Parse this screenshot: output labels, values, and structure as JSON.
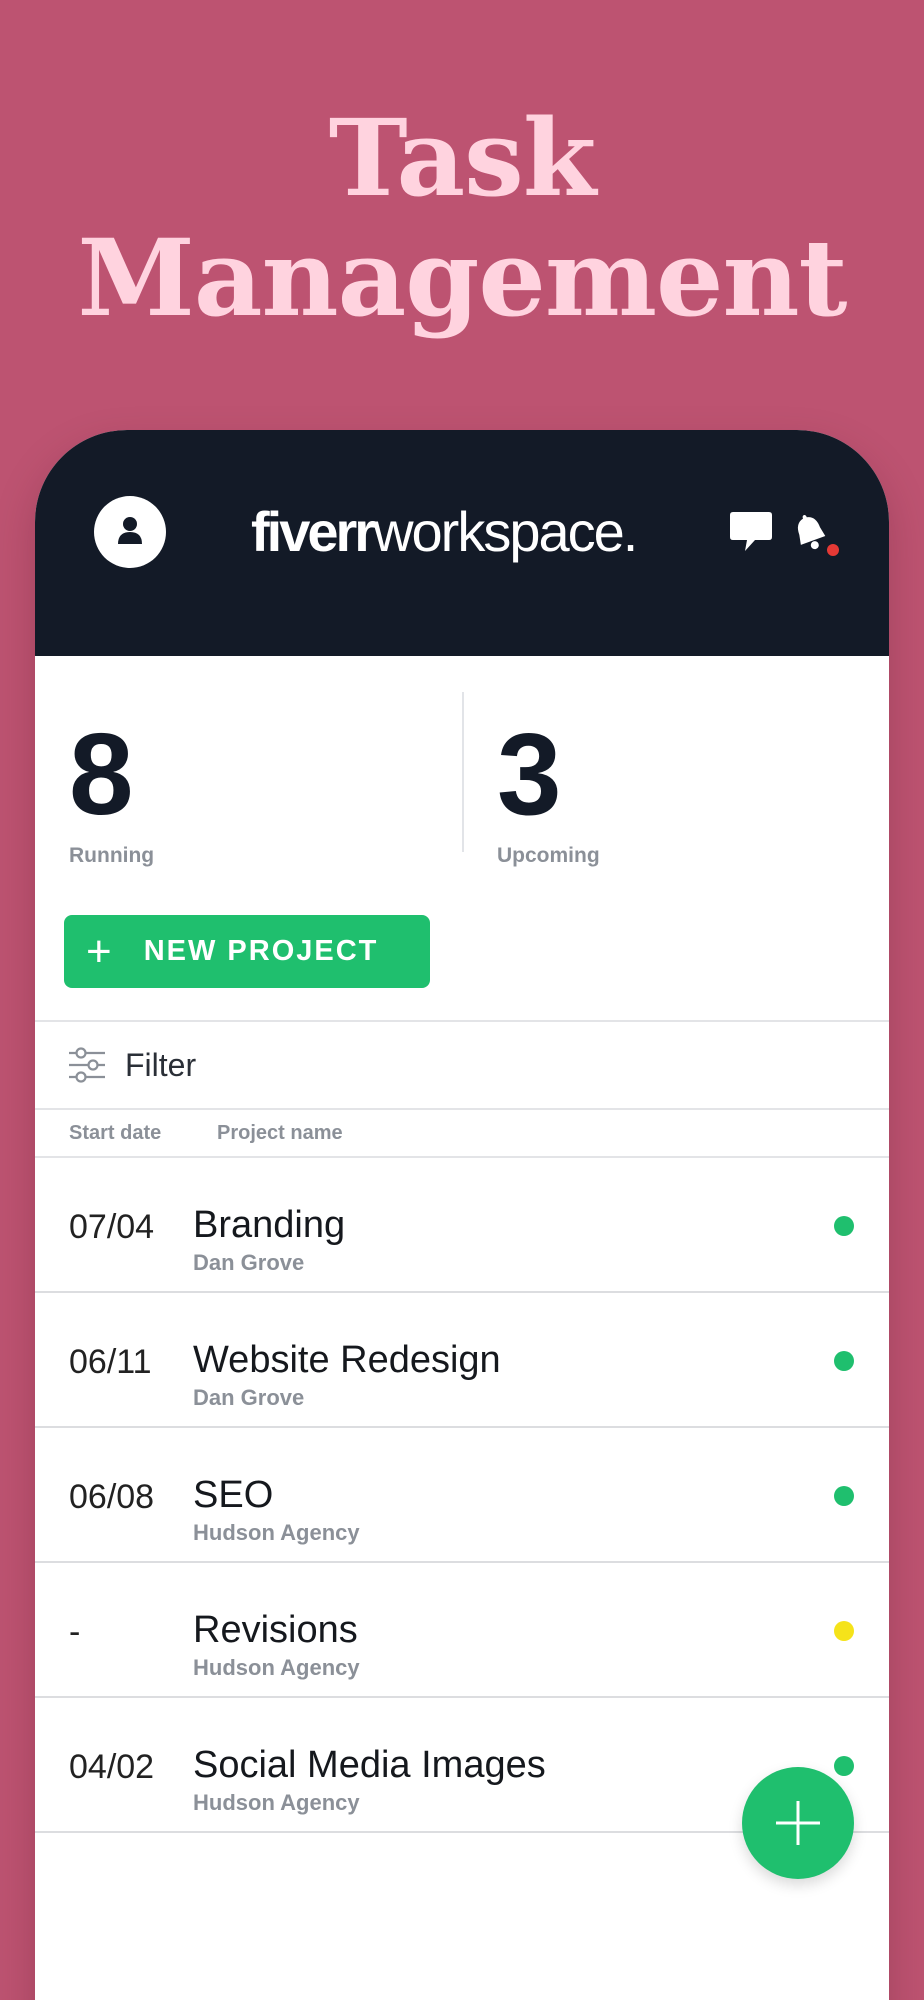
{
  "headline": {
    "line1": "Task",
    "line2": "Management"
  },
  "header": {
    "brand_bold": "fiverr",
    "brand_light": "workspace."
  },
  "stats": {
    "running": {
      "value": "8",
      "label": "Running"
    },
    "upcoming": {
      "value": "3",
      "label": "Upcoming"
    }
  },
  "actions": {
    "new_project_label": "NEW PROJECT"
  },
  "filter": {
    "label": "Filter"
  },
  "table": {
    "columns": {
      "start_date": "Start date",
      "project_name": "Project name"
    },
    "rows": [
      {
        "date": "07/04",
        "title": "Branding",
        "client": "Dan Grove",
        "status_color": "#1fbf6e"
      },
      {
        "date": "06/11",
        "title": "Website Redesign",
        "client": "Dan Grove",
        "status_color": "#1fbf6e"
      },
      {
        "date": "06/08",
        "title": "SEO",
        "client": "Hudson Agency",
        "status_color": "#1fbf6e"
      },
      {
        "date": "-",
        "title": "Revisions",
        "client": "Hudson Agency",
        "status_color": "#f5e31a"
      },
      {
        "date": "04/02",
        "title": "Social Media Images",
        "client": "Hudson Agency",
        "status_color": "#1fbf6e"
      }
    ]
  },
  "colors": {
    "background": "#bd5371",
    "headline": "#ffd3df",
    "header": "#131a27",
    "accent_green": "#1fbf6e",
    "notification_dot": "#e53935"
  },
  "icons": {
    "avatar": "user-icon",
    "chat": "chat-bubble-icon",
    "bell": "bell-icon",
    "filter": "sliders-icon",
    "fab": "plus-icon"
  }
}
